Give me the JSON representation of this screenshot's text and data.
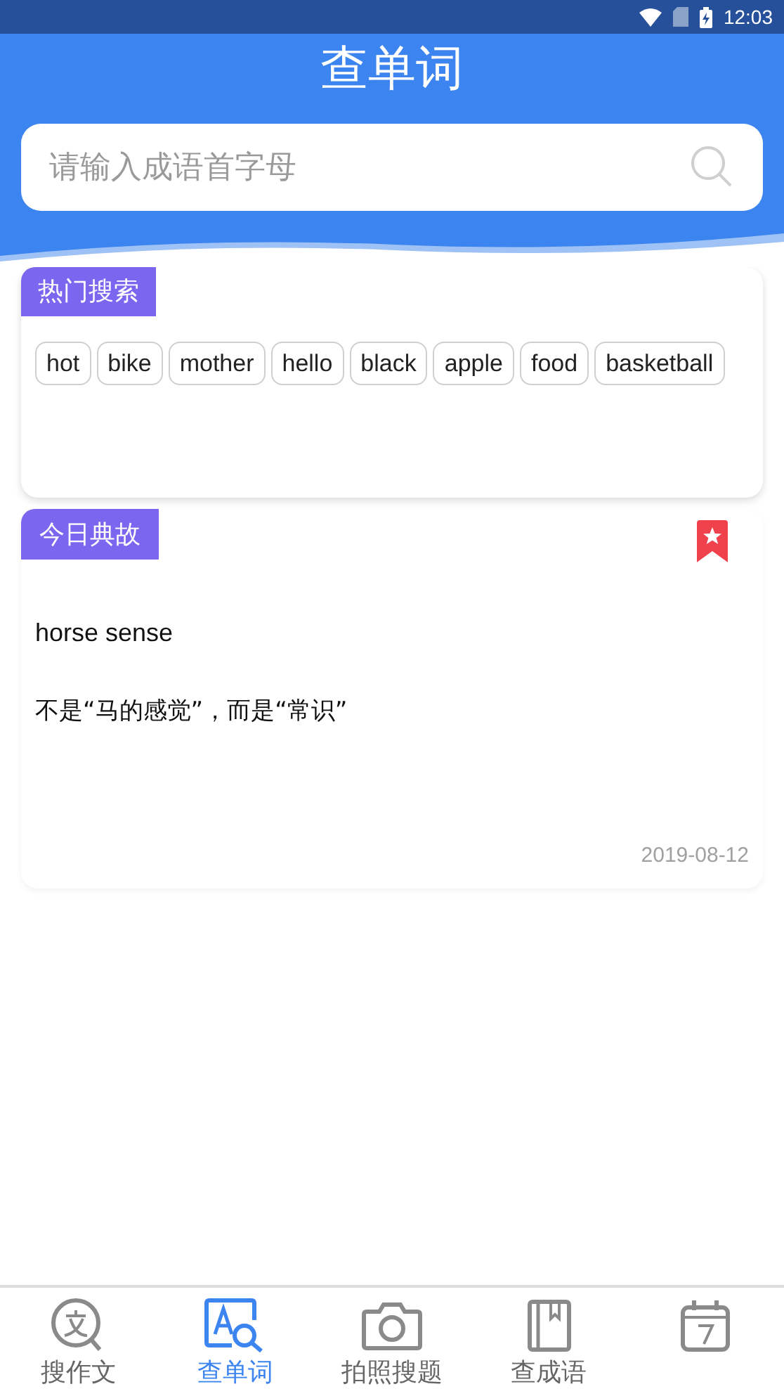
{
  "status_bar": {
    "time": "12:03"
  },
  "header": {
    "title": "查单词"
  },
  "search": {
    "placeholder": "请输入成语首字母"
  },
  "hot_search": {
    "label": "热门搜索",
    "tags": [
      "hot",
      "bike",
      "mother",
      "hello",
      "black",
      "apple",
      "food",
      "basketball"
    ]
  },
  "daily_story": {
    "label": "今日典故",
    "bookmarked": true,
    "phrase": "horse sense",
    "meaning": "不是“马的感觉”，而是“常识”",
    "date": "2019-08-12"
  },
  "bottom_nav": [
    {
      "kind": "essay",
      "label": "搜作文",
      "selected": false
    },
    {
      "kind": "word",
      "label": "查单词",
      "selected": true
    },
    {
      "kind": "camera",
      "label": "拍照搜题",
      "selected": false
    },
    {
      "kind": "idiom",
      "label": "查成语",
      "selected": false
    },
    {
      "kind": "calendar",
      "selected": false
    }
  ]
}
